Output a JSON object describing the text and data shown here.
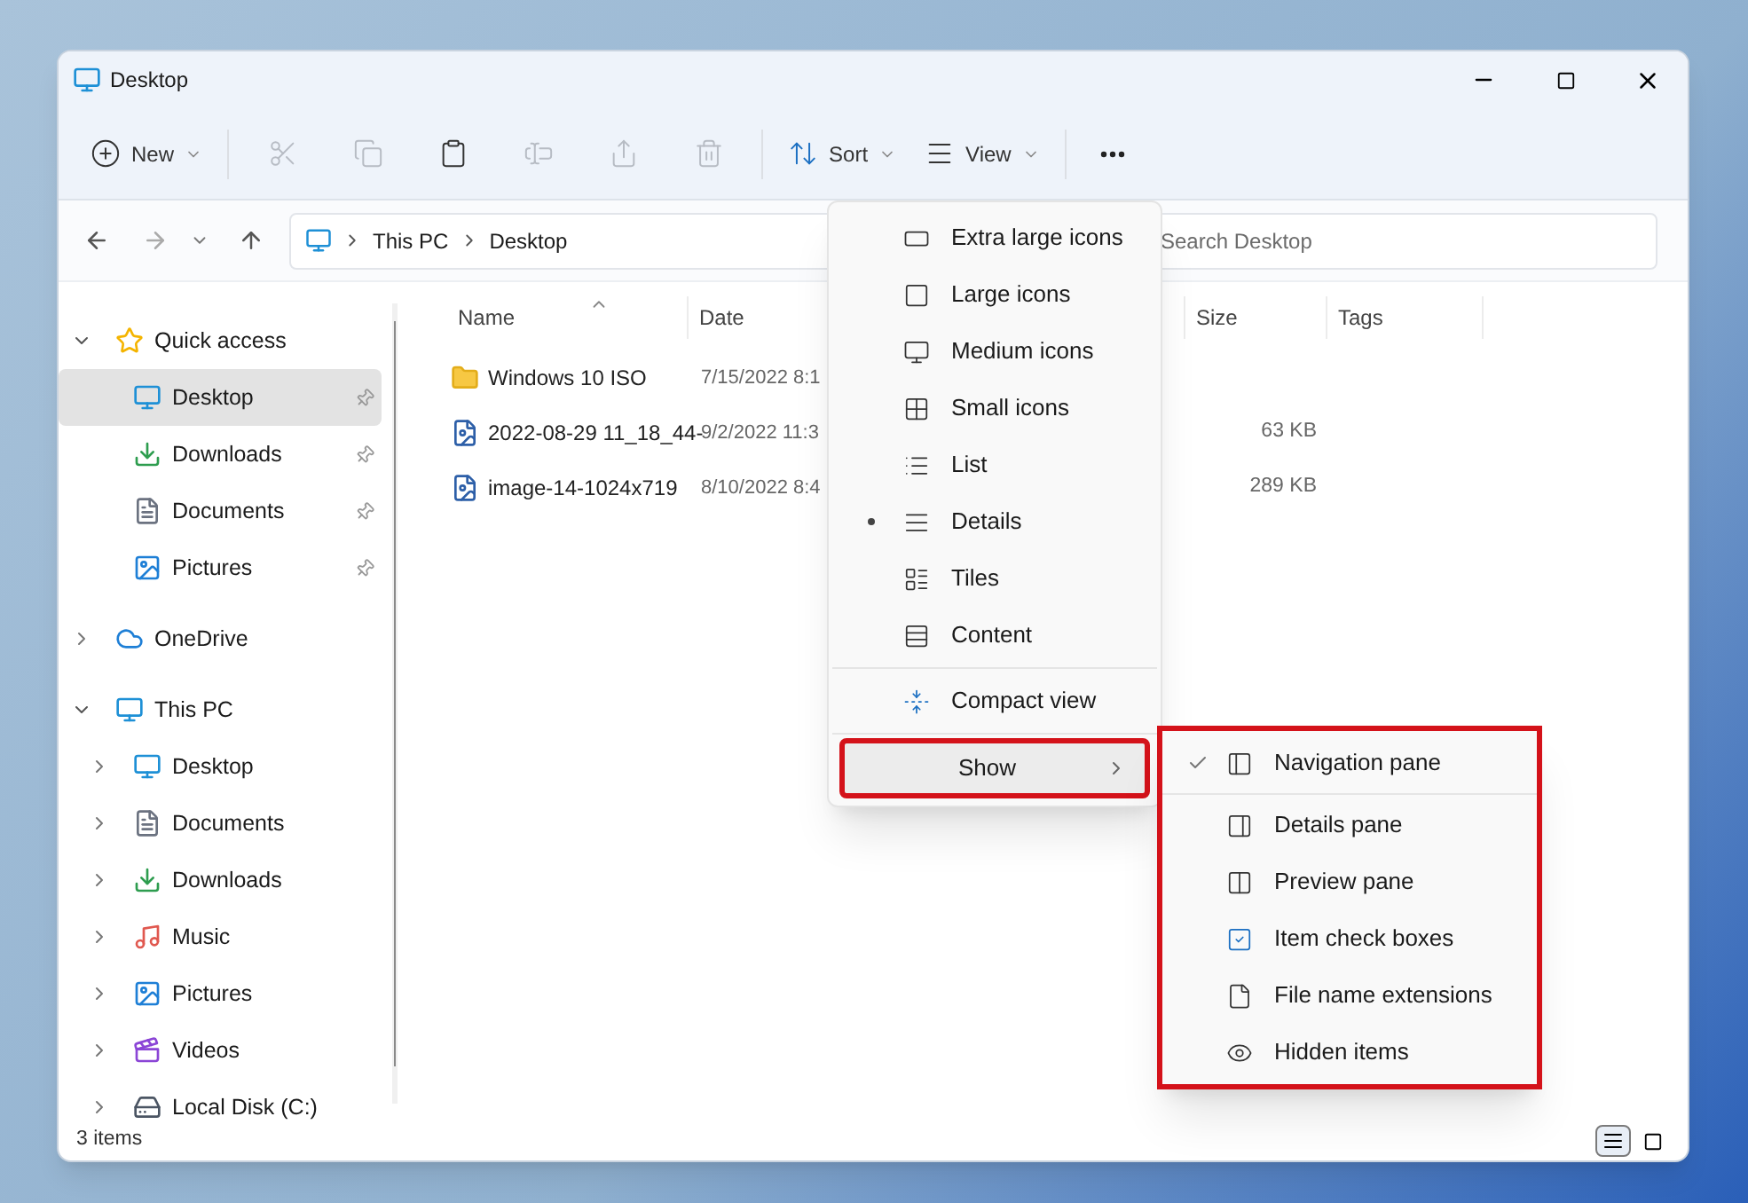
{
  "window": {
    "title": "Desktop"
  },
  "toolbar": [
    {
      "label": "New",
      "caret": true,
      "disabled": false
    },
    {
      "disabled": true
    },
    {
      "disabled": true
    },
    {
      "disabled": false
    },
    {
      "disabled": true
    },
    {
      "disabled": true
    },
    {
      "disabled": true
    },
    {
      "label": "Sort",
      "caret": true,
      "disabled": false
    },
    {
      "label": "View",
      "caret": true,
      "disabled": false
    }
  ],
  "address": {
    "segments": [
      "This PC",
      "Desktop"
    ]
  },
  "search": {
    "placeholder": "Search Desktop"
  },
  "sidebar": [
    {
      "label": "Quick access",
      "expanded": true,
      "children": [
        {
          "label": "Desktop",
          "selected": true,
          "pinned": true
        },
        {
          "label": "Downloads",
          "selected": false,
          "pinned": true
        },
        {
          "label": "Documents",
          "selected": false,
          "pinned": true
        },
        {
          "label": "Pictures",
          "selected": false,
          "pinned": true
        }
      ]
    },
    {
      "label": "OneDrive",
      "expanded": false
    },
    {
      "label": "This PC",
      "expanded": true,
      "children": [
        {
          "label": "Desktop",
          "selected": false,
          "expanded": false
        },
        {
          "label": "Documents",
          "selected": false,
          "expanded": false
        },
        {
          "label": "Downloads",
          "selected": false,
          "expanded": false
        },
        {
          "label": "Music",
          "selected": false,
          "expanded": false
        },
        {
          "label": "Pictures",
          "selected": false,
          "expanded": false
        },
        {
          "label": "Videos",
          "selected": false,
          "expanded": false
        },
        {
          "label": "Local Disk (C:)",
          "selected": false,
          "expanded": false
        }
      ]
    }
  ],
  "table": {
    "columns": [
      "Name",
      "Date",
      "Size",
      "Tags"
    ],
    "rows": [
      {
        "kind": "folder",
        "name": "Windows 10 ISO",
        "date": "7/15/2022 8:1"
      },
      {
        "kind": "image",
        "name": "2022-08-29 11_18_44-",
        "date": "9/2/2022 11:3",
        "size": "63 KB"
      },
      {
        "kind": "image",
        "name": "image-14-1024x719",
        "date": "8/10/2022 8:4",
        "size": "289 KB"
      }
    ]
  },
  "status_bar": {
    "text": "3 items",
    "view_toggles": [
      {
        "selected": true
      },
      {
        "selected": false
      }
    ]
  },
  "view_menu": [
    {
      "kind": "option",
      "label": "Extra large icons",
      "selected": false
    },
    {
      "kind": "option",
      "label": "Large icons",
      "selected": false
    },
    {
      "kind": "option",
      "label": "Medium icons",
      "selected": false
    },
    {
      "kind": "option",
      "label": "Small icons",
      "selected": false
    },
    {
      "kind": "option",
      "label": "List",
      "selected": false
    },
    {
      "kind": "option",
      "label": "Details",
      "selected": true
    },
    {
      "kind": "option",
      "label": "Tiles",
      "selected": false
    },
    {
      "kind": "option",
      "label": "Content",
      "selected": false
    },
    {
      "kind": "toggle",
      "label": "Compact view",
      "checked": false
    },
    {
      "kind": "submenu",
      "label": "Show",
      "highlighted": true,
      "outlined": true
    }
  ],
  "show_menu": {
    "outlined": true,
    "items": [
      {
        "label": "Navigation pane",
        "checked": true
      },
      {
        "label": "Details pane",
        "checked": false
      },
      {
        "label": "Preview pane",
        "checked": false
      },
      {
        "label": "Item check boxes",
        "checked": false
      },
      {
        "label": "File name extensions",
        "checked": false
      },
      {
        "label": "Hidden items",
        "checked": false
      }
    ]
  }
}
